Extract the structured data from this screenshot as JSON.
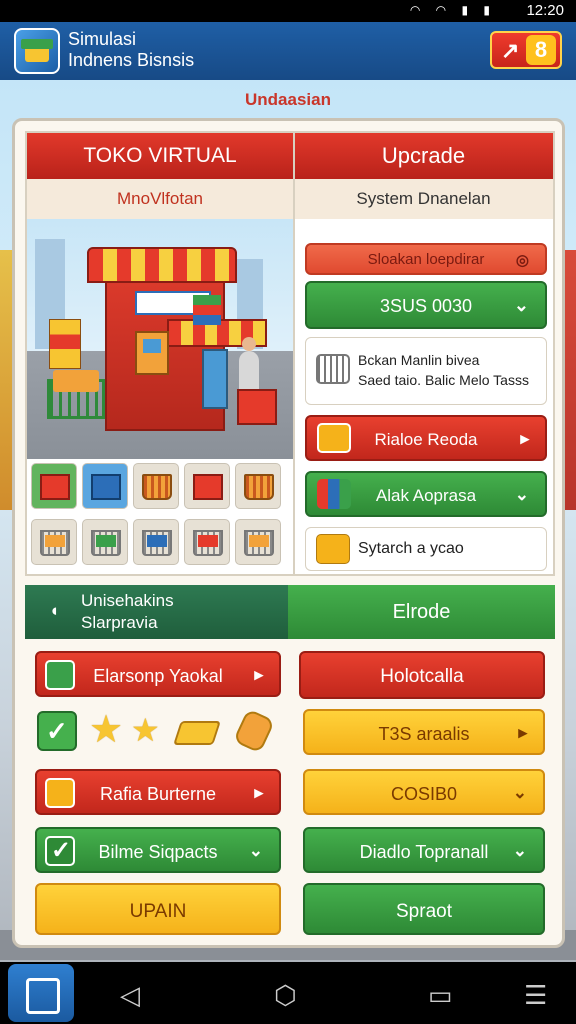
{
  "status": {
    "time": "12:20",
    "icons": "◠ ◠ ▮ ▮"
  },
  "app": {
    "title_line1": "Simulasi",
    "title_line2": "Indnens Bisnsis",
    "badge_value": "8",
    "badge_arrow": "↗"
  },
  "page_heading": "Undaasian",
  "top": {
    "tab_left": "TOKO VIRTUAL",
    "tab_right": "Upcrade",
    "sub_left": "MnoVlfotan",
    "sub_right": "System Dnanelan",
    "right_items": [
      {
        "label": "Sloakan loepdirar",
        "chev": "◎"
      },
      {
        "label": "3SUS 0030",
        "chev": "⌄"
      },
      {
        "line1": "Bckan Manlin bivea",
        "line2": "Saed taio. Balic Melo Tasss"
      },
      {
        "label": "Rialoe Reoda",
        "chev": "▸"
      },
      {
        "label": "Alak Aoprasa",
        "chev": "⌄"
      },
      {
        "label": "Sytarch a ycao"
      }
    ]
  },
  "bottom": {
    "tab_left_line1": "Unisehakins",
    "tab_left_line2": "Slarpravia",
    "tab_left_icon": "◖",
    "tab_right": "Elrode",
    "left_buttons": [
      {
        "label": "Elarsonp Yaokal",
        "chev": "▸"
      },
      {
        "label": "Rafia Burterne",
        "chev": "▸"
      },
      {
        "label": "Bilme Siqpacts",
        "chev": "⌄"
      },
      {
        "label": "UPAIN"
      }
    ],
    "right_buttons": [
      {
        "label": "Holotcalla"
      },
      {
        "label": "T3S araalis",
        "chev": "▸"
      },
      {
        "label": "COSIB0",
        "chev": "⌄"
      },
      {
        "label": "Diadlo Topranall",
        "chev": "⌄"
      },
      {
        "label": "Spraot"
      }
    ],
    "stars": [
      "★",
      "★"
    ]
  },
  "nav": {
    "back": "◁",
    "home": "⬡",
    "recent": "▭",
    "menu": "☰"
  }
}
